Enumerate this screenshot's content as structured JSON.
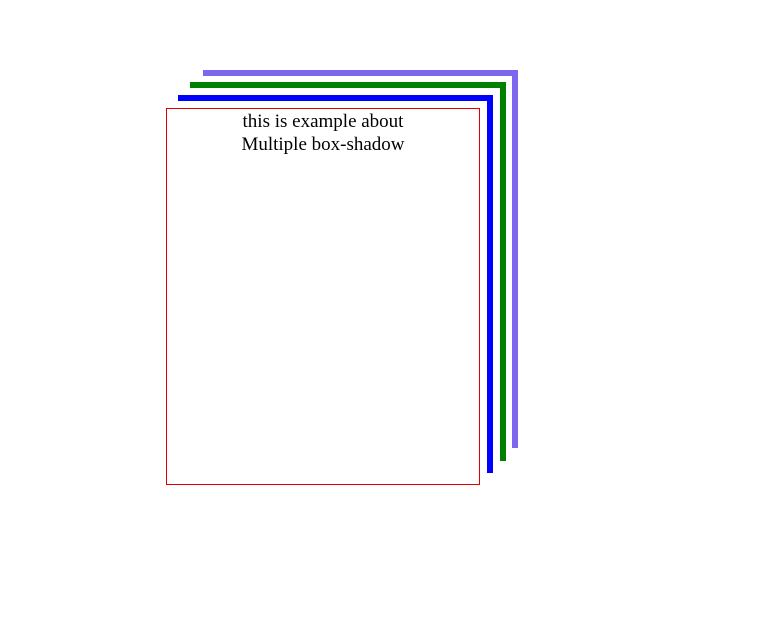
{
  "box": {
    "line1": "this is example about",
    "line2": "Multiple box-shadow"
  },
  "colors": {
    "border": "#e00000",
    "shadow_1": "#0000ff",
    "shadow_2": "#008000",
    "shadow_3": "#7b68ee",
    "background": "#ffffff"
  }
}
